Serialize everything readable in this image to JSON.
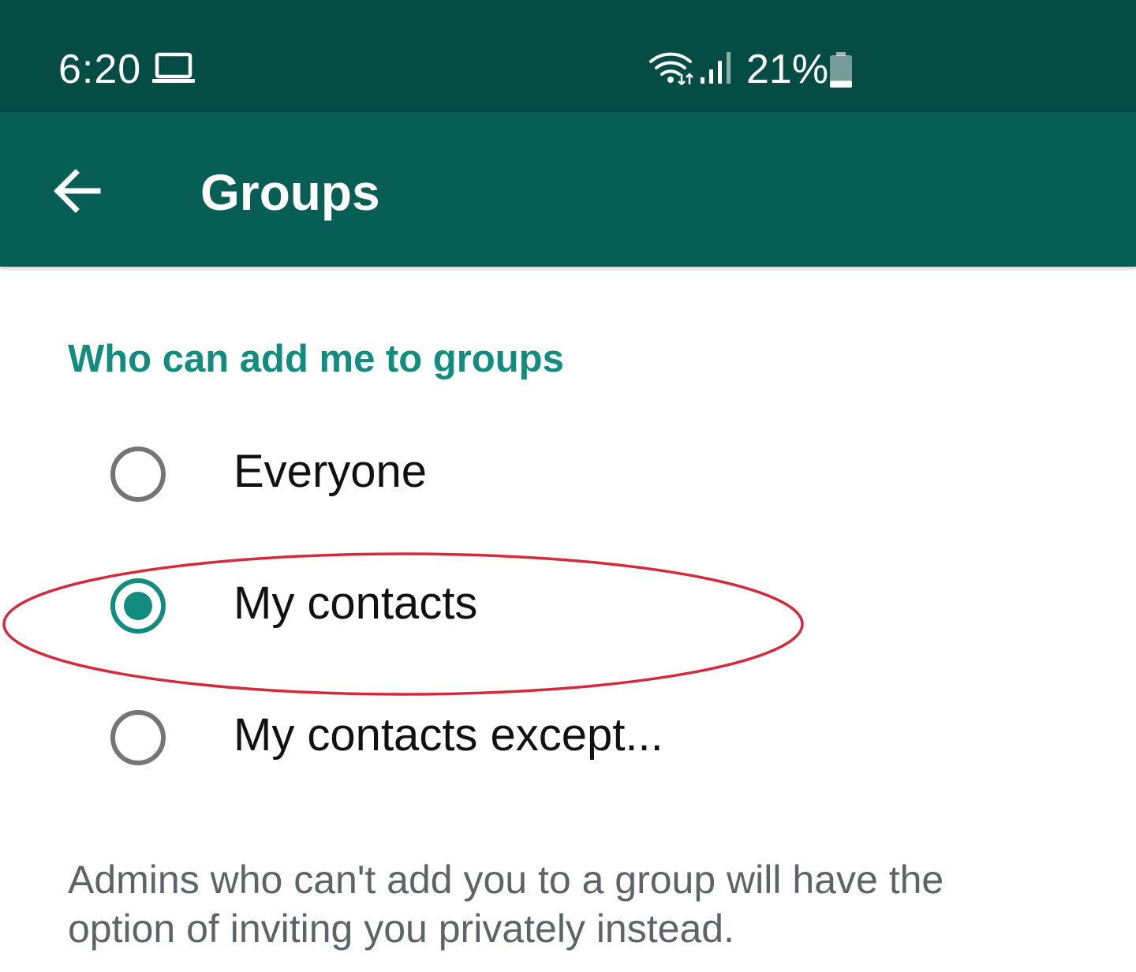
{
  "status_bar": {
    "time": "6:20",
    "battery_percent": "21%",
    "battery_level": 0.21,
    "icons": [
      "laptop-icon",
      "wifi-icon",
      "signal-icon",
      "battery-icon"
    ]
  },
  "app_bar": {
    "back_icon": "arrow-left-icon",
    "title": "Groups"
  },
  "section": {
    "header": "Who can add me to groups",
    "options": [
      {
        "label": "Everyone",
        "selected": false
      },
      {
        "label": "My contacts",
        "selected": true
      },
      {
        "label": "My contacts except...",
        "selected": false
      }
    ],
    "helper_text": "Admins who can't add you to a group will have the option of inviting you privately instead."
  },
  "colors": {
    "status_bar": "#054c44",
    "app_bar": "#075e54",
    "accent": "#128c7e",
    "annotation": "#d42a3c"
  }
}
